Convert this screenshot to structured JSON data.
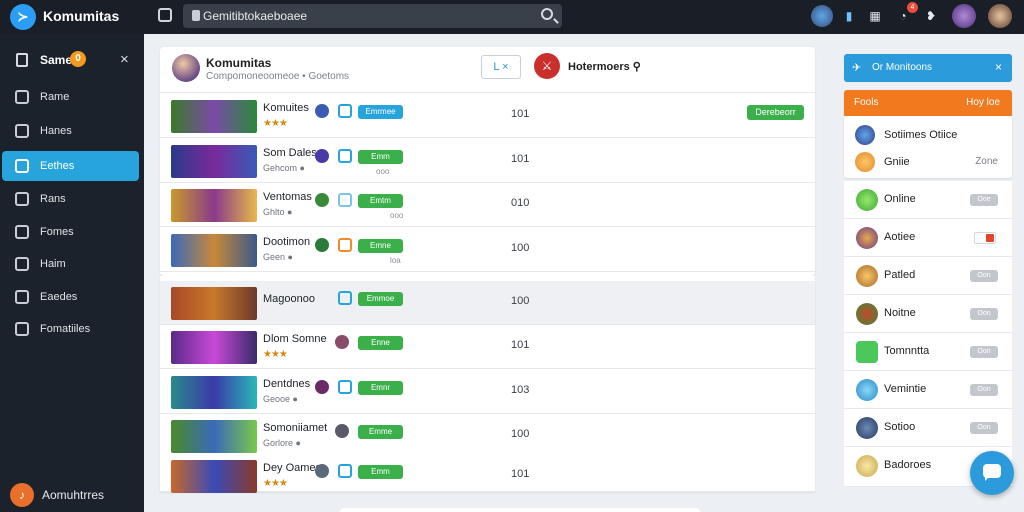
{
  "topbar": {
    "app_title": "Komumitas",
    "search_value": "Gemitibtokaeboaee",
    "notification_count": "4",
    "icons": [
      "logo-icon",
      "window-icon",
      "search-icon",
      "avatar-1",
      "bar-chart-icon",
      "grid-icon",
      "notification-icon",
      "heart-icon",
      "avatar-2",
      "avatar-3"
    ]
  },
  "sidebar": {
    "header_label": "Same",
    "header_badge": "0",
    "items": [
      {
        "label": "Rame",
        "icon": "home-icon"
      },
      {
        "label": "Hanes",
        "icon": "arrow-icon"
      },
      {
        "label": "Eethes",
        "icon": "games-icon",
        "active": true
      },
      {
        "label": "Rans",
        "icon": "people-icon"
      },
      {
        "label": "Fomes",
        "icon": "list-icon"
      },
      {
        "label": "Haim",
        "icon": "link-icon"
      },
      {
        "label": "Eaedes",
        "icon": "controller-icon"
      },
      {
        "label": "Fomatiiles",
        "icon": "grid-icon"
      }
    ],
    "footer_label": "Aomuhtrres"
  },
  "main": {
    "header": {
      "title": "Komumitas",
      "subtitle": "Compomoneoomeoe • Goetoms",
      "button_label": "L ×",
      "brand_label": "Hotermoers ⚲"
    },
    "rows": [
      {
        "name": "Komuites",
        "sub": "",
        "stars": "★★★",
        "tag": "Emrmee",
        "tag_color": "blue",
        "count": "101",
        "mini": "",
        "right_tag": "Derebeorr"
      },
      {
        "name": "Som Dales",
        "sub": "Gehcom ●",
        "stars": "",
        "tag": "Emm",
        "tag_color": "green",
        "count": "101",
        "mini": "ooo",
        "right_tag": ""
      },
      {
        "name": "Ventomas",
        "sub": "Ghlto ●",
        "stars": "",
        "tag": "Emtm",
        "tag_color": "green",
        "count": "010",
        "mini": "ooo",
        "right_tag": ""
      },
      {
        "name": "Dootimon",
        "sub": "Geen ●",
        "stars": "",
        "tag": "Emne",
        "tag_color": "blue",
        "count": "100",
        "mini": "loa",
        "right_tag": ""
      },
      {
        "name": "Magoonoo",
        "sub": "",
        "stars": "",
        "tag": "Emmoe",
        "tag_color": "green",
        "count": "100",
        "mini": "",
        "right_tag": ""
      },
      {
        "name": "Dlom Somne",
        "sub": "",
        "stars": "★★★",
        "tag": "Enne",
        "tag_color": "green",
        "count": "101",
        "mini": "",
        "right_tag": ""
      },
      {
        "name": "Dentdnes",
        "sub": "Geooe ●",
        "stars": "",
        "tag": "Emnr",
        "tag_color": "green",
        "count": "103",
        "mini": "",
        "right_tag": ""
      },
      {
        "name": "Somoniiamet",
        "sub": "Gorlore ●",
        "stars": "",
        "tag": "Emme",
        "tag_color": "green",
        "count": "100",
        "mini": "",
        "right_tag": ""
      },
      {
        "name": "Dey Oames",
        "sub": "",
        "stars": "★★★",
        "tag": "Emm",
        "tag_color": "green",
        "count": "101",
        "mini": "",
        "right_tag": ""
      }
    ]
  },
  "right_panel": {
    "header_label": "Or Monitoons",
    "card": {
      "orange_left": "Fools",
      "orange_right": "Hoy loe",
      "line1_name": "Sotiimes Otiice",
      "line2_name": "Gniie",
      "line2_status": "Zone"
    },
    "friends": [
      {
        "name": "Online",
        "toggle": "Ooe"
      },
      {
        "name": "Aotiee",
        "toggle": ""
      },
      {
        "name": "Patled",
        "toggle": "Oon"
      },
      {
        "name": "Noitne",
        "toggle": "Oon"
      },
      {
        "name": "Tomnntta",
        "toggle": "Oon"
      },
      {
        "name": "Vemintie",
        "toggle": "Oon"
      },
      {
        "name": "Sotioo",
        "toggle": "Oon"
      },
      {
        "name": "Badoroes",
        "toggle": ""
      }
    ]
  },
  "colors": {
    "topbar_bg": "#1a1f27",
    "sidebar_bg": "#1c222b",
    "accent_blue": "#27a4dc",
    "accent_green": "#3aaf4a",
    "accent_orange": "#f27a1e"
  }
}
